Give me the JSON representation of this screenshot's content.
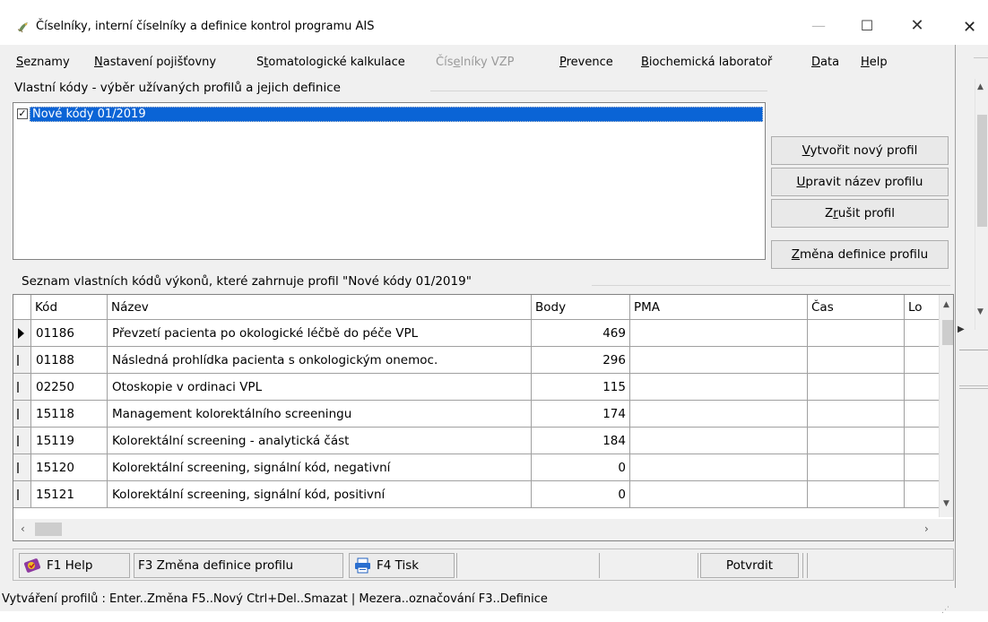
{
  "window": {
    "title": "Číselníky, interní číselníky a definice kontrol programu AIS",
    "minimize": "—",
    "maximize": "☐",
    "close": "✕"
  },
  "background_window": {
    "close": "✕"
  },
  "menu": [
    {
      "label": "Seznamy",
      "u": 0
    },
    {
      "label": "Nastavení pojišťovny",
      "u": 0
    },
    {
      "label": "Stomatologické kalkulace",
      "u": 1
    },
    {
      "label": "Číselníky VZP",
      "u": 3,
      "disabled": true
    },
    {
      "label": "Prevence",
      "u": 0
    },
    {
      "label": "Biochemická laboratoř",
      "u": 0
    },
    {
      "label": "Data",
      "u": 0
    },
    {
      "label": "Help",
      "u": 0
    }
  ],
  "profiles_group": {
    "label": "Vlastní kódy - výběr užívaných profilů a jejich definice",
    "items": [
      {
        "label": "Nové kódy 01/2019",
        "checked": true
      }
    ]
  },
  "profile_buttons": {
    "create": {
      "label": "Vytvořit nový profil",
      "u": 0
    },
    "rename": {
      "label": "Upravit název profilu",
      "u": 0
    },
    "delete": {
      "label": "Zrušit profil",
      "u": 1
    },
    "change_def": {
      "label": "Změna definice profilu",
      "u": 0
    }
  },
  "codes_group": {
    "label": "Seznam vlastních kódů výkonů, které zahrnuje profil \"Nové kódy 01/2019\""
  },
  "table": {
    "columns": [
      "Kód",
      "Název",
      "Body",
      "PMA",
      "Čas",
      "Lo"
    ],
    "rows": [
      {
        "kod": "01186",
        "nazev": "Převzetí pacienta po okologické léčbě do péče VPL",
        "body": "469",
        "current": true
      },
      {
        "kod": "01188",
        "nazev": "Následná prohlídka pacienta s onkologickým onemoc.",
        "body": "296"
      },
      {
        "kod": "02250",
        "nazev": "Otoskopie v ordinaci VPL",
        "body": "115"
      },
      {
        "kod": "15118",
        "nazev": "Management kolorektálního screeningu",
        "body": "174"
      },
      {
        "kod": "15119",
        "nazev": "Kolorektální screening - analytická část",
        "body": "184"
      },
      {
        "kod": "15120",
        "nazev": "Kolorektální screening, signální kód, negativní",
        "body": "0"
      },
      {
        "kod": "15121",
        "nazev": "Kolorektální screening, signální kód, positivní",
        "body": "0"
      }
    ]
  },
  "toolbar": {
    "help": "F1 Help",
    "change_def": "F3 Změna definice profilu",
    "print": "F4 Tisk",
    "confirm": "Potvrdit"
  },
  "status_bar": "Vytváření profilů : Enter..Změna  F5..Nový  Ctrl+Del..Smazat | Mezera..označování  F3..Definice"
}
